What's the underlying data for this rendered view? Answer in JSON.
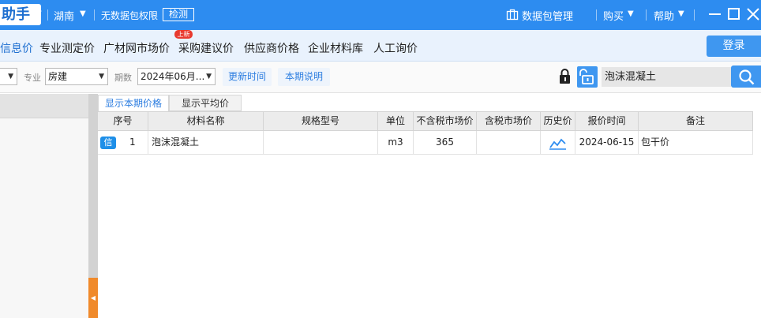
{
  "titlebar": {
    "logo_text": "助手",
    "region": "湖南",
    "permission_text": "无数据包权限",
    "check_label": "检测",
    "data_package_label": "数据包管理",
    "buy_label": "购买",
    "help_label": "帮助"
  },
  "nav": {
    "items": [
      {
        "label": "信息价"
      },
      {
        "label": "专业测定价"
      },
      {
        "label": "广材网市场价"
      },
      {
        "label": "采购建议价"
      },
      {
        "label": "供应商价格"
      },
      {
        "label": "企业材料库"
      },
      {
        "label": "人工询价"
      }
    ],
    "badge": "上新",
    "login_label": "登录"
  },
  "filters": {
    "specialty_label": "专业",
    "specialty_value": "房建",
    "period_label": "期数",
    "period_value": "2024年06月...",
    "update_time_label": "更新时间",
    "period_note_label": "本期说明",
    "search_value": "泡沫混凝土"
  },
  "subtabs": {
    "current": "显示本期价格",
    "average": "显示平均价"
  },
  "table": {
    "headers": [
      "序号",
      "材料名称",
      "规格型号",
      "单位",
      "不含税市场价",
      "含税市场价",
      "历史价",
      "报价时间",
      "备注"
    ],
    "rows": [
      {
        "badge": "信",
        "index": "1",
        "name": "泡沫混凝土",
        "spec": "",
        "unit": "m3",
        "price_excl_tax": "365",
        "price_incl_tax": "",
        "quote_date": "2024-06-15",
        "remark": "包干价"
      }
    ]
  },
  "colors": {
    "accent": "#2d8cf0",
    "nav_bg": "#e9f2fd",
    "badge_red": "#e83a2f",
    "splitter_orange": "#f08a2b"
  },
  "icons": {
    "package": "briefcase-icon",
    "lock": "lock-icon",
    "unlock": "unlock-icon",
    "search": "search-icon",
    "history": "trend-chart-icon"
  }
}
